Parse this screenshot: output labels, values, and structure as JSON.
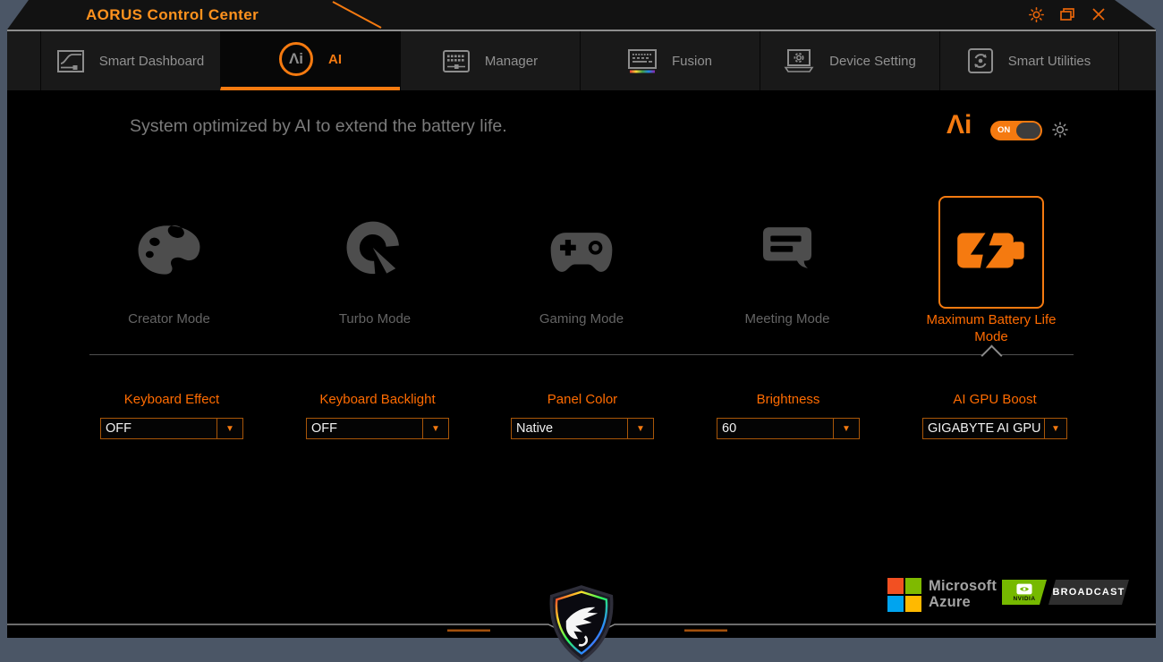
{
  "window": {
    "title": "AORUS Control Center",
    "controls": {
      "settings": "brightness",
      "restore": "restore",
      "close": "close"
    }
  },
  "tabs": [
    {
      "label": "Smart Dashboard",
      "active": false
    },
    {
      "label": "AI",
      "active": true
    },
    {
      "label": "Manager",
      "active": false
    },
    {
      "label": "Fusion",
      "active": false
    },
    {
      "label": "Device Setting",
      "active": false
    },
    {
      "label": "Smart Utilities",
      "active": false
    }
  ],
  "ai": {
    "logo": "Λi",
    "description": "System optimized by AI to extend the battery life.",
    "toggle": "ON"
  },
  "modes": [
    {
      "label": "Creator Mode",
      "selected": false
    },
    {
      "label": "Turbo Mode",
      "selected": false
    },
    {
      "label": "Gaming Mode",
      "selected": false
    },
    {
      "label": "Meeting Mode",
      "selected": false
    },
    {
      "label": "Maximum Battery Life Mode",
      "selected": true
    }
  ],
  "settings": [
    {
      "label": "Keyboard Effect",
      "value": "OFF"
    },
    {
      "label": "Keyboard Backlight",
      "value": "OFF"
    },
    {
      "label": "Panel Color",
      "value": "Native"
    },
    {
      "label": "Brightness",
      "value": "60"
    },
    {
      "label": "AI GPU Boost",
      "value": "GIGABYTE AI GPU"
    }
  ],
  "footer": {
    "microsoft_line1": "Microsoft",
    "microsoft_line2": "Azure",
    "nvidia_brand": "NVIDIA",
    "nvidia_label": "BROADCAST"
  },
  "colors": {
    "accent": "#f57a10",
    "label_orange": "#ff6b00",
    "title_orange": "#ff921e",
    "frame": "#4b5666",
    "background": "#000000",
    "ms_red": "#f25022",
    "ms_green": "#7fba00",
    "ms_blue": "#00a4ef",
    "ms_yellow": "#ffb900",
    "nvidia_green": "#76b900"
  }
}
